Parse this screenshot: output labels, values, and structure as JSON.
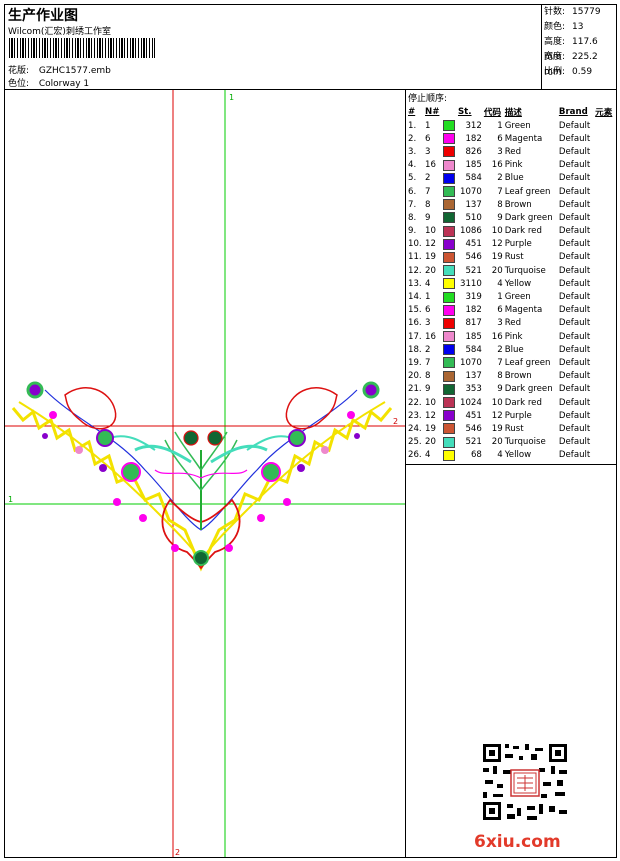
{
  "header": {
    "title": "生产作业图",
    "subtitle": "Wilcom(汇宏)刺绣工作室",
    "design_label": "花版:",
    "design_value": "GZHC1577.emb",
    "colorway_label": "色位:",
    "colorway_value": "Colorway 1"
  },
  "specs": [
    {
      "label": "针数:",
      "value": "15779"
    },
    {
      "label": "颜色:",
      "value": "13"
    },
    {
      "label": "高度:",
      "value": "117.6 mm"
    },
    {
      "label": "宽度:",
      "value": "225.2 mm"
    },
    {
      "label": "比例:",
      "value": "0.59"
    }
  ],
  "guides": {
    "vertical_left": "2",
    "vertical_right": "1",
    "horizontal_top": "2",
    "horizontal_bottom": "1"
  },
  "stop_sequence": {
    "title": "停止顺序:",
    "columns": [
      "#",
      "N#",
      "St.",
      "代码",
      "描述",
      "Brand",
      "元素"
    ],
    "rows": [
      {
        "idx": "1.",
        "n": "1",
        "color": "#22dd22",
        "st": "312",
        "code": "1",
        "desc": "Green",
        "brand": "Default"
      },
      {
        "idx": "2.",
        "n": "6",
        "color": "#ff00ee",
        "st": "182",
        "code": "6",
        "desc": "Magenta",
        "brand": "Default"
      },
      {
        "idx": "3.",
        "n": "3",
        "color": "#ee0000",
        "st": "826",
        "code": "3",
        "desc": "Red",
        "brand": "Default"
      },
      {
        "idx": "4.",
        "n": "16",
        "color": "#ee88cc",
        "st": "185",
        "code": "16",
        "desc": "Pink",
        "brand": "Default"
      },
      {
        "idx": "5.",
        "n": "2",
        "color": "#0000ee",
        "st": "584",
        "code": "2",
        "desc": "Blue",
        "brand": "Default"
      },
      {
        "idx": "6.",
        "n": "7",
        "color": "#33bb55",
        "st": "1070",
        "code": "7",
        "desc": "Leaf green",
        "brand": "Default"
      },
      {
        "idx": "7.",
        "n": "8",
        "color": "#aa6633",
        "st": "137",
        "code": "8",
        "desc": "Brown",
        "brand": "Default"
      },
      {
        "idx": "8.",
        "n": "9",
        "color": "#116633",
        "st": "510",
        "code": "9",
        "desc": "Dark green",
        "brand": "Default"
      },
      {
        "idx": "9.",
        "n": "10",
        "color": "#bb3355",
        "st": "1086",
        "code": "10",
        "desc": "Dark red",
        "brand": "Default"
      },
      {
        "idx": "10.",
        "n": "12",
        "color": "#8800cc",
        "st": "451",
        "code": "12",
        "desc": "Purple",
        "brand": "Default"
      },
      {
        "idx": "11.",
        "n": "19",
        "color": "#cc5533",
        "st": "546",
        "code": "19",
        "desc": "Rust",
        "brand": "Default"
      },
      {
        "idx": "12.",
        "n": "20",
        "color": "#44ddbb",
        "st": "521",
        "code": "20",
        "desc": "Turquoise",
        "brand": "Default"
      },
      {
        "idx": "13.",
        "n": "4",
        "color": "#ffff00",
        "st": "3110",
        "code": "4",
        "desc": "Yellow",
        "brand": "Default"
      },
      {
        "idx": "14.",
        "n": "1",
        "color": "#22dd22",
        "st": "319",
        "code": "1",
        "desc": "Green",
        "brand": "Default"
      },
      {
        "idx": "15.",
        "n": "6",
        "color": "#ff00ee",
        "st": "182",
        "code": "6",
        "desc": "Magenta",
        "brand": "Default"
      },
      {
        "idx": "16.",
        "n": "3",
        "color": "#ee0000",
        "st": "817",
        "code": "3",
        "desc": "Red",
        "brand": "Default"
      },
      {
        "idx": "17.",
        "n": "16",
        "color": "#ee88cc",
        "st": "185",
        "code": "16",
        "desc": "Pink",
        "brand": "Default"
      },
      {
        "idx": "18.",
        "n": "2",
        "color": "#0000ee",
        "st": "584",
        "code": "2",
        "desc": "Blue",
        "brand": "Default"
      },
      {
        "idx": "19.",
        "n": "7",
        "color": "#33bb55",
        "st": "1070",
        "code": "7",
        "desc": "Leaf green",
        "brand": "Default"
      },
      {
        "idx": "20.",
        "n": "8",
        "color": "#aa6633",
        "st": "137",
        "code": "8",
        "desc": "Brown",
        "brand": "Default"
      },
      {
        "idx": "21.",
        "n": "9",
        "color": "#116633",
        "st": "353",
        "code": "9",
        "desc": "Dark green",
        "brand": "Default"
      },
      {
        "idx": "22.",
        "n": "10",
        "color": "#bb3355",
        "st": "1024",
        "code": "10",
        "desc": "Dark red",
        "brand": "Default"
      },
      {
        "idx": "23.",
        "n": "12",
        "color": "#8800cc",
        "st": "451",
        "code": "12",
        "desc": "Purple",
        "brand": "Default"
      },
      {
        "idx": "24.",
        "n": "19",
        "color": "#cc5533",
        "st": "546",
        "code": "19",
        "desc": "Rust",
        "brand": "Default"
      },
      {
        "idx": "25.",
        "n": "20",
        "color": "#44ddbb",
        "st": "521",
        "code": "20",
        "desc": "Turquoise",
        "brand": "Default"
      },
      {
        "idx": "26.",
        "n": "4",
        "color": "#ffff00",
        "st": "68",
        "code": "4",
        "desc": "Yellow",
        "brand": "Default"
      }
    ]
  },
  "watermark": {
    "text": "6xiu.com",
    "color": "#e23a2a"
  },
  "qr_icon": "qr-code-icon"
}
